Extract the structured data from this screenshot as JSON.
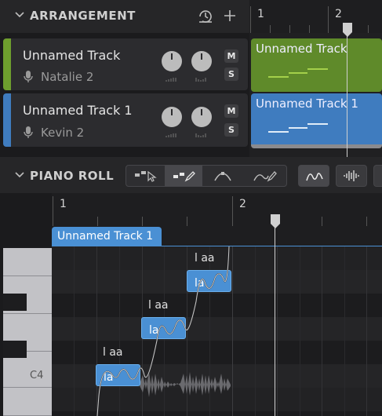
{
  "arrangement": {
    "title": "ARRANGEMENT",
    "ruler": [
      "1",
      "2"
    ],
    "tracks": [
      {
        "name": "Unnamed Track",
        "singer": "Natalie 2",
        "mute": "M",
        "solo": "S",
        "color": "#6e9e2e"
      },
      {
        "name": "Unnamed Track 1",
        "singer": "Kevin 2",
        "mute": "M",
        "solo": "S",
        "color": "#3f7cbf"
      }
    ],
    "clips": [
      {
        "title": "Unnamed Track",
        "color": "#5f8a2a"
      },
      {
        "title": "Unnamed Track 1",
        "color": "#3f7cbf"
      }
    ]
  },
  "piano_roll": {
    "title": "PIANO ROLL",
    "ruler": [
      "1",
      "2"
    ],
    "clip_label": "Unnamed Track 1",
    "notes": [
      {
        "lyric": "la",
        "phoneme": "l aa"
      },
      {
        "lyric": "la",
        "phoneme": "l aa"
      },
      {
        "lyric": "la",
        "phoneme": "l aa"
      }
    ],
    "key_label": "C4"
  },
  "colors": {
    "accent": "#4a90d4",
    "track1": "#6e9e2e",
    "track2": "#3f7cbf"
  }
}
